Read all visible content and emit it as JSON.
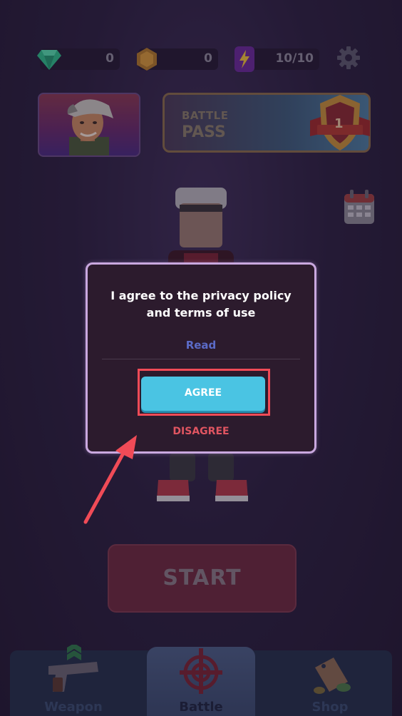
{
  "resources": {
    "gems": "0",
    "coins": "0",
    "energy": "10/10"
  },
  "battle_pass": {
    "line1": "BATTLE",
    "line2": "PASS",
    "level": "1"
  },
  "dialog": {
    "message_line1": "I agree to the privacy policy",
    "message_line2": "and terms of use",
    "read_label": "Read",
    "agree_label": "AGREE",
    "disagree_label": "DISAGREE"
  },
  "start_label": "START",
  "nav": {
    "weapon": "Weapon",
    "battle": "Battle",
    "shop": "Shop"
  },
  "colors": {
    "agree_button": "#4ac4e3",
    "disagree_text": "#e05561",
    "highlight": "#f04b57",
    "dialog_border": "#c9a8df"
  }
}
